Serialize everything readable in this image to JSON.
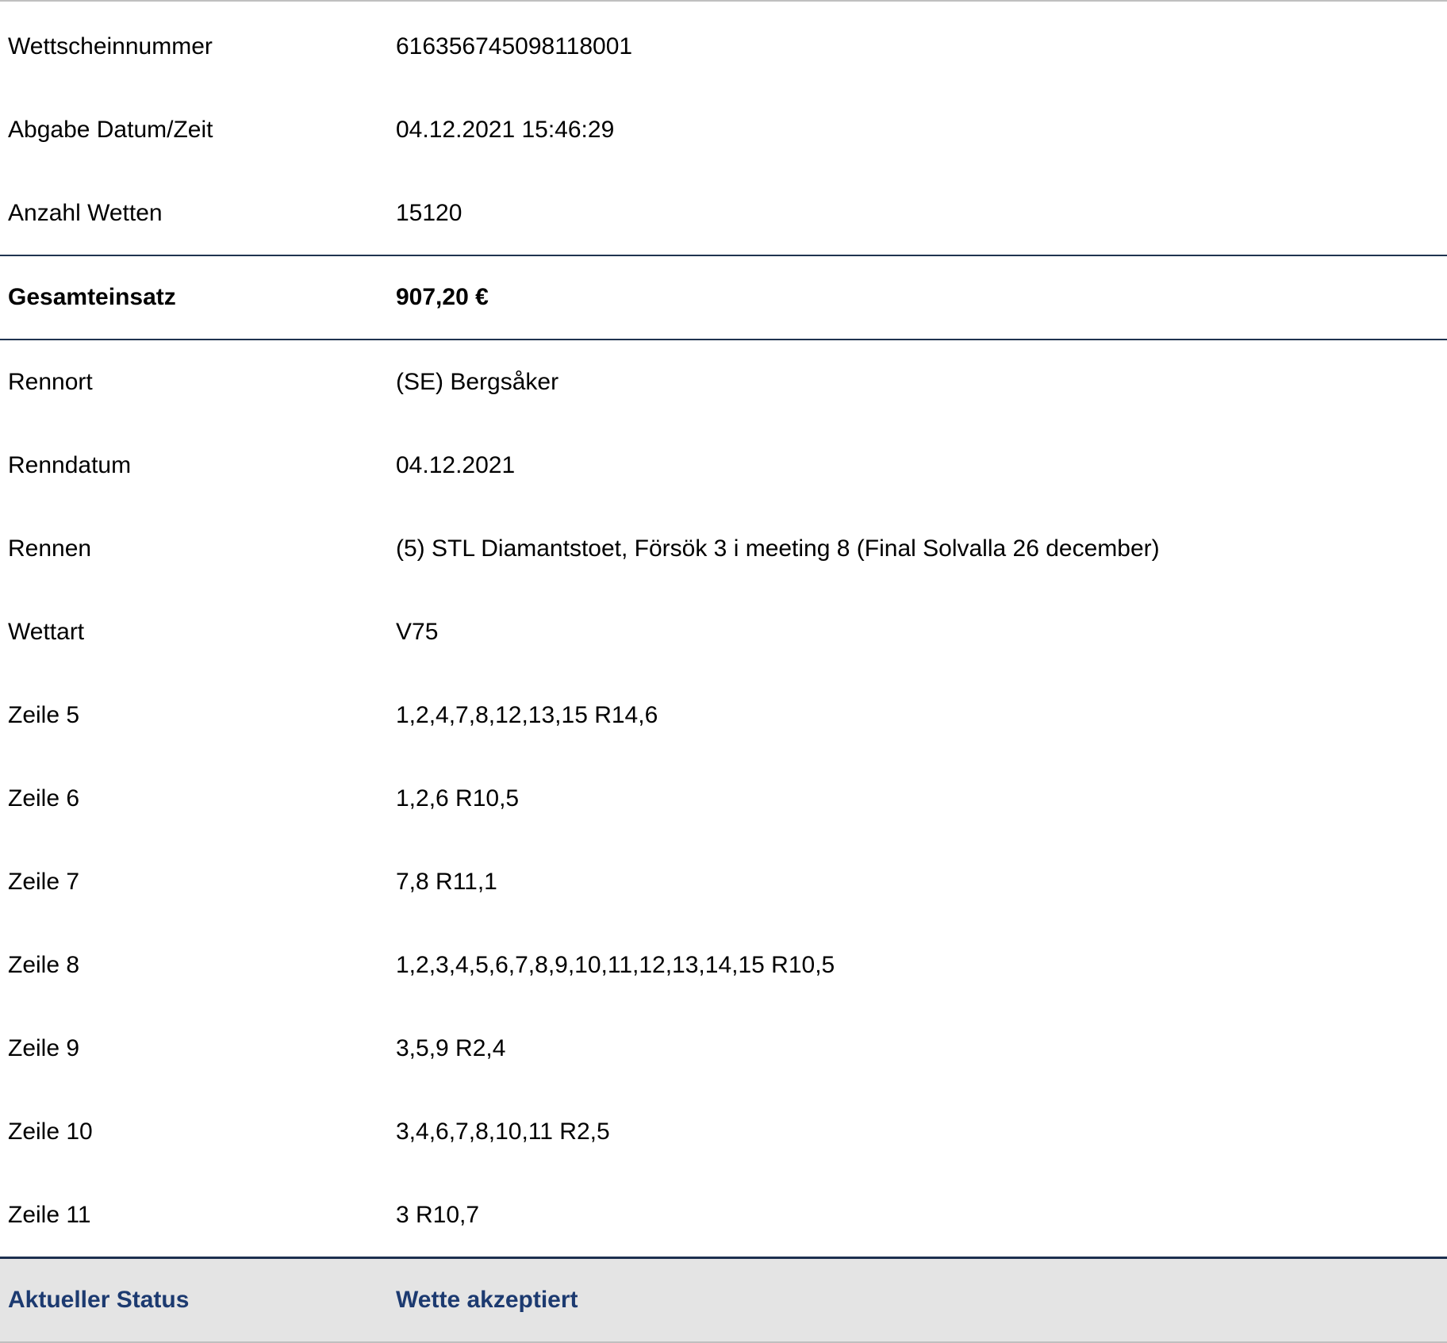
{
  "summary": [
    {
      "label": "Wettscheinnummer",
      "value": "616356745098118001"
    },
    {
      "label": "Abgabe Datum/Zeit",
      "value": "04.12.2021 15:46:29"
    },
    {
      "label": "Anzahl Wetten",
      "value": "15120"
    }
  ],
  "total": {
    "label": "Gesamteinsatz",
    "value": "907,20 €"
  },
  "details": [
    {
      "label": "Rennort",
      "value": "(SE) Bergsåker"
    },
    {
      "label": "Renndatum",
      "value": "04.12.2021"
    },
    {
      "label": "Rennen",
      "value": "(5) STL Diamantstoet, Försök 3 i meeting 8 (Final Solvalla 26 december)"
    },
    {
      "label": "Wettart",
      "value": "V75"
    },
    {
      "label": "Zeile 5",
      "value": "1,2,4,7,8,12,13,15 R14,6"
    },
    {
      "label": "Zeile 6",
      "value": "1,2,6 R10,5"
    },
    {
      "label": "Zeile 7",
      "value": "7,8 R11,1"
    },
    {
      "label": "Zeile 8",
      "value": "1,2,3,4,5,6,7,8,9,10,11,12,13,14,15 R10,5"
    },
    {
      "label": "Zeile 9",
      "value": "3,5,9 R2,4"
    },
    {
      "label": "Zeile 10",
      "value": "3,4,6,7,8,10,11 R2,5"
    },
    {
      "label": "Zeile 11",
      "value": "3 R10,7"
    }
  ],
  "status": {
    "label": "Aktueller Status",
    "value": "Wette akzeptiert"
  },
  "colors": {
    "status_text": "#1c3a70",
    "status_bg": "#e4e4e4",
    "divider": "#1f3350"
  }
}
